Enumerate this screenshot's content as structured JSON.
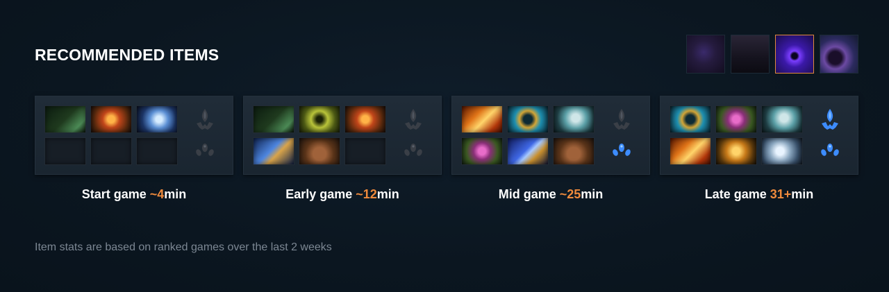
{
  "header": {
    "title": "RECOMMENDED ITEMS"
  },
  "abilities": [
    {
      "icon": "ability-1-icon",
      "selected": false
    },
    {
      "icon": "ability-2-icon",
      "selected": false
    },
    {
      "icon": "ability-3-icon",
      "selected": true
    },
    {
      "icon": "ability-4-icon",
      "selected": false
    }
  ],
  "colors": {
    "accent": "#ef8a3c",
    "selected_border": "#e28a3d",
    "background": "#0b1620"
  },
  "stages": [
    {
      "prefix": "Start game ",
      "time": "~4",
      "suffix": "min",
      "items": [
        "wand",
        "bracer",
        "orb",
        "empty",
        "empty",
        "empty"
      ],
      "neutral": [
        "dark-token-icon",
        "dark-gem-icon"
      ]
    },
    {
      "prefix": "Early game ",
      "time": "~12",
      "suffix": "min",
      "items": [
        "wand",
        "poison",
        "bracer",
        "blade",
        "boots",
        "empty"
      ],
      "neutral": [
        "dark-token-icon",
        "dark-gem-icon"
      ]
    },
    {
      "prefix": "Mid game ",
      "time": "~25",
      "suffix": "min",
      "items": [
        "sword",
        "gyro",
        "helm",
        "octa",
        "staff",
        "boots"
      ],
      "neutral": [
        "dark-token-icon",
        "blue-gem-icon"
      ]
    },
    {
      "prefix": "Late game ",
      "time": "31+",
      "suffix": "min",
      "items": [
        "gyro",
        "octa",
        "helm",
        "sword",
        "cuirass",
        "hammer"
      ],
      "neutral": [
        "blue-token-icon",
        "blue-gem-icon"
      ]
    }
  ],
  "footnote": "Item stats are based on ranked games over the last 2 weeks"
}
